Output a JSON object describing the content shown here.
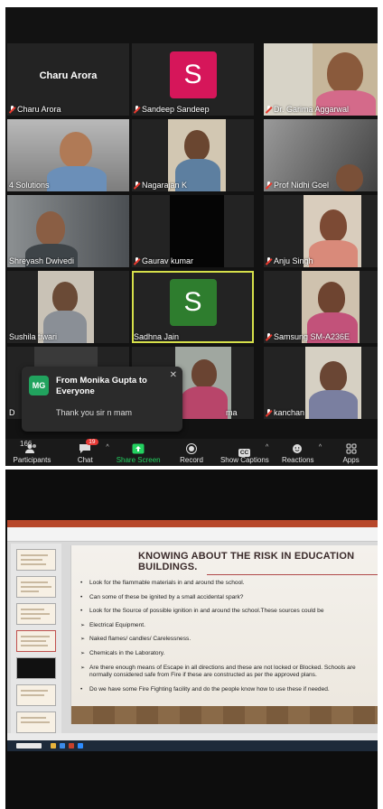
{
  "zoom": {
    "participants": [
      {
        "name": "Charu Arora",
        "display_text": "Charu Arora",
        "type": "name-only"
      },
      {
        "name": "Sandeep Sandeep",
        "initial": "S",
        "type": "avatar",
        "color": "#d6165a"
      },
      {
        "name": "Dr. Garima Aggarwal",
        "type": "video"
      },
      {
        "name": "4 Solutions",
        "type": "video"
      },
      {
        "name": "Nagarajan K",
        "type": "video"
      },
      {
        "name": "Prof Nidhi Goel",
        "type": "video"
      },
      {
        "name": "Shreyash Dwivedi",
        "type": "video"
      },
      {
        "name": "Gaurav kumar",
        "type": "video-off"
      },
      {
        "name": "Anju Singh",
        "type": "video"
      },
      {
        "name": "Sushila tiwari",
        "type": "video"
      },
      {
        "name": "Sadhna Jain",
        "initial": "S",
        "type": "avatar",
        "color": "#2e7d2e",
        "active_speaker": true
      },
      {
        "name": "Samsung SM-A236E",
        "type": "video"
      },
      {
        "name": "D",
        "type": "video"
      },
      {
        "name": "ma",
        "type": "video"
      },
      {
        "name": "kanchan",
        "type": "video"
      }
    ],
    "chat_toast": {
      "initials": "MG",
      "from": "From Monika Gupta to Everyone",
      "message": "Thank you sir n mam",
      "close": "✕"
    },
    "toolbar": {
      "participants_label": "Participants",
      "participants_count": "166",
      "chat_label": "Chat",
      "chat_badge": "19",
      "share_label": "Share Screen",
      "record_label": "Record",
      "captions_label": "Show Captions",
      "captions_icon_text": "CC",
      "reactions_label": "Reactions",
      "apps_label": "Apps"
    },
    "colors": {
      "accent_share": "#23d160",
      "speaker_border": "#d6e04a"
    }
  },
  "ppt": {
    "heading": "KNOWING ABOUT THE RISK IN EDUCATION BUILDINGS.",
    "points": [
      {
        "style": "dot",
        "text": "Look for the flammable materials in and around the school."
      },
      {
        "style": "dot",
        "text": "Can some of these be ignited by a small accidental spark?"
      },
      {
        "style": "dot",
        "text": "Look for the Source of possible ignition in and around the school.These sources could be"
      },
      {
        "style": "arr",
        "text": "Electrical Equipment."
      },
      {
        "style": "arr",
        "text": "Naked flames/ candles/ Carelessness."
      },
      {
        "style": "arr",
        "text": "Chemicals in the Laboratory."
      },
      {
        "style": "arr",
        "text": "Are there enough means of Escape in all directions and these are not locked or Blocked. Schools are normally considered safe from Fire if these are constructed as per the approved plans."
      },
      {
        "style": "dot",
        "text": "Do we have some Fire Fighting facility and do the people know how to use these if needed."
      }
    ]
  }
}
